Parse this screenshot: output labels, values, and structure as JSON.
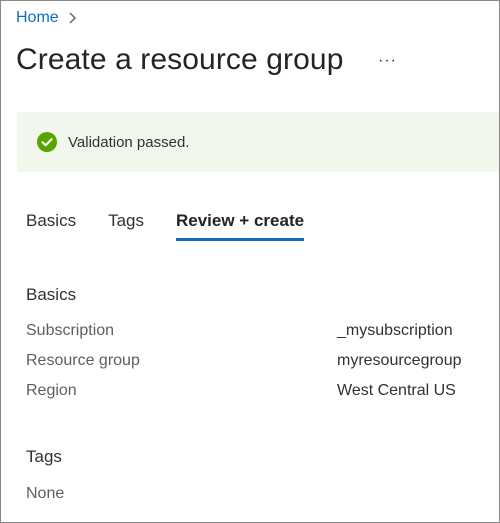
{
  "breadcrumb": {
    "home_label": "Home"
  },
  "header": {
    "title": "Create a resource group",
    "more_label": "···"
  },
  "banner": {
    "message": "Validation passed.",
    "status_color": "#57a300"
  },
  "tabs": [
    {
      "label": "Basics",
      "selected": false
    },
    {
      "label": "Tags",
      "selected": false
    },
    {
      "label": "Review + create",
      "selected": true
    }
  ],
  "basics": {
    "heading": "Basics",
    "rows": [
      {
        "label": "Subscription",
        "value": "_mysubscription"
      },
      {
        "label": "Resource group",
        "value": "myresourcegroup"
      },
      {
        "label": "Region",
        "value": "West Central US"
      }
    ]
  },
  "tags": {
    "heading": "Tags",
    "value": "None"
  },
  "colors": {
    "accent": "#0f6cbd",
    "banner_bg": "#f1f8eb"
  }
}
